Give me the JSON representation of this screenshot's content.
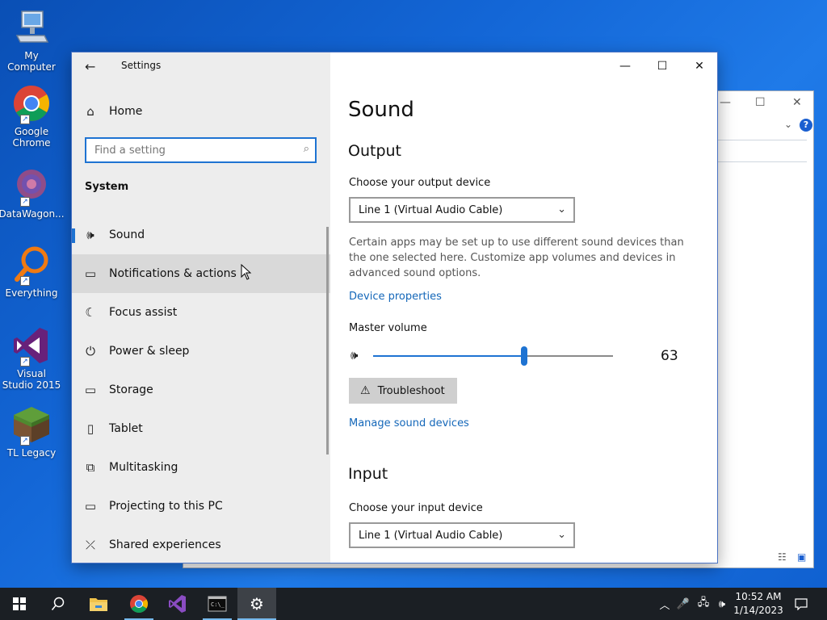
{
  "desktop": {
    "icons": [
      {
        "label": "My Computer",
        "icon": "computer-icon"
      },
      {
        "label": "Google Chrome",
        "icon": "chrome-icon"
      },
      {
        "label": "DataWagon...",
        "icon": "datawagon-icon"
      },
      {
        "label": "Everything",
        "icon": "search-magnifier-icon"
      },
      {
        "label": "Visual Studio 2015",
        "icon": "visual-studio-icon"
      },
      {
        "label": "TL Legacy",
        "icon": "grass-block-icon"
      }
    ]
  },
  "settings": {
    "title": "Settings",
    "nav": {
      "home_label": "Home",
      "search_placeholder": "Find a setting",
      "section": "System",
      "items": [
        {
          "label": "Sound",
          "icon": "speaker-icon",
          "selected": true
        },
        {
          "label": "Notifications & actions",
          "icon": "notification-icon",
          "hover": true
        },
        {
          "label": "Focus assist",
          "icon": "moon-icon"
        },
        {
          "label": "Power & sleep",
          "icon": "power-icon"
        },
        {
          "label": "Storage",
          "icon": "storage-icon"
        },
        {
          "label": "Tablet",
          "icon": "tablet-icon"
        },
        {
          "label": "Multitasking",
          "icon": "multitasking-icon"
        },
        {
          "label": "Projecting to this PC",
          "icon": "projector-icon"
        },
        {
          "label": "Shared experiences",
          "icon": "shared-icon"
        }
      ]
    },
    "content": {
      "heading": "Sound",
      "output_heading": "Output",
      "output_device_label": "Choose your output device",
      "output_device_value": "Line 1 (Virtual Audio Cable)",
      "description": "Certain apps may be set up to use different sound devices than the one selected here. Customize app volumes and devices in advanced sound options.",
      "device_properties_link": "Device properties",
      "master_volume_label": "Master volume",
      "volume_value": "63",
      "volume_fraction": 0.63,
      "troubleshoot_label": "Troubleshoot",
      "manage_devices_link": "Manage sound devices",
      "input_heading": "Input",
      "input_device_label": "Choose your input device",
      "input_device_value": "Line 1 (Virtual Audio Cable)"
    }
  },
  "taskbar": {
    "time": "10:52 AM",
    "date": "1/14/2023",
    "accent_color": "#76b9ed"
  }
}
